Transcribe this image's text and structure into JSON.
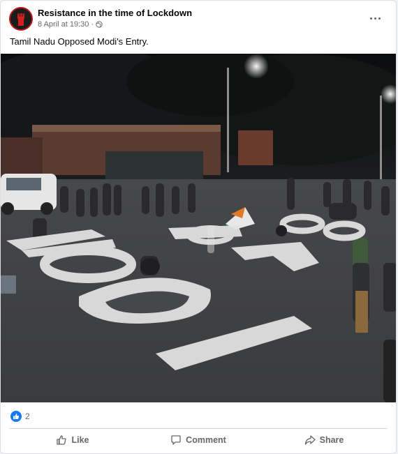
{
  "post": {
    "page_name": "Resistance in the time of Lockdown",
    "timestamp": "8 April at 19:30 · ",
    "privacy_icon": "globe-icon",
    "caption": "Tamil Nadu Opposed Modi's Entry.",
    "image_painted_text": "GO BACK MODI"
  },
  "reactions": {
    "type": "like",
    "count": "2"
  },
  "actions": {
    "like_label": "Like",
    "comment_label": "Comment",
    "share_label": "Share"
  },
  "colors": {
    "brand_blue": "#1877f2",
    "secondary_text": "#65676b",
    "avatar_red": "#c21a1a"
  }
}
